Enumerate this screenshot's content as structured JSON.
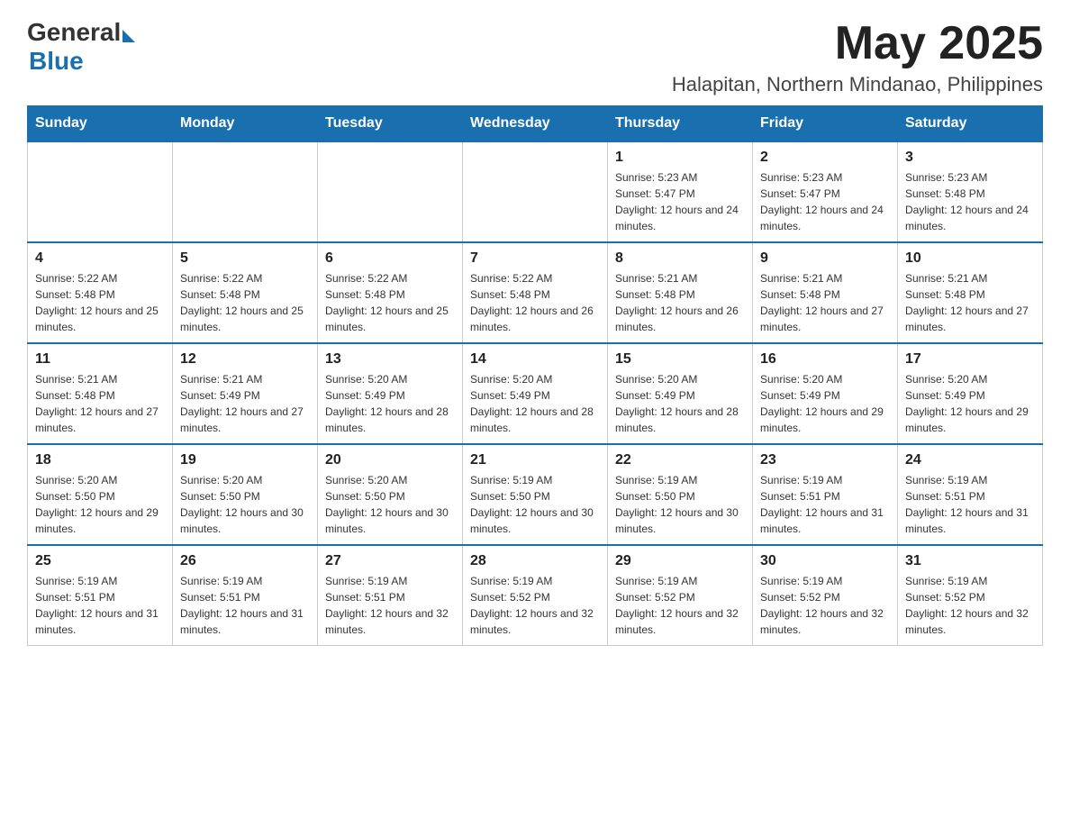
{
  "header": {
    "logo": {
      "general": "General",
      "blue": "Blue"
    },
    "monthYear": "May 2025",
    "location": "Halapitan, Northern Mindanao, Philippines"
  },
  "weekdays": [
    "Sunday",
    "Monday",
    "Tuesday",
    "Wednesday",
    "Thursday",
    "Friday",
    "Saturday"
  ],
  "weeks": [
    [
      {
        "day": "",
        "info": ""
      },
      {
        "day": "",
        "info": ""
      },
      {
        "day": "",
        "info": ""
      },
      {
        "day": "",
        "info": ""
      },
      {
        "day": "1",
        "info": "Sunrise: 5:23 AM\nSunset: 5:47 PM\nDaylight: 12 hours and 24 minutes."
      },
      {
        "day": "2",
        "info": "Sunrise: 5:23 AM\nSunset: 5:47 PM\nDaylight: 12 hours and 24 minutes."
      },
      {
        "day": "3",
        "info": "Sunrise: 5:23 AM\nSunset: 5:48 PM\nDaylight: 12 hours and 24 minutes."
      }
    ],
    [
      {
        "day": "4",
        "info": "Sunrise: 5:22 AM\nSunset: 5:48 PM\nDaylight: 12 hours and 25 minutes."
      },
      {
        "day": "5",
        "info": "Sunrise: 5:22 AM\nSunset: 5:48 PM\nDaylight: 12 hours and 25 minutes."
      },
      {
        "day": "6",
        "info": "Sunrise: 5:22 AM\nSunset: 5:48 PM\nDaylight: 12 hours and 25 minutes."
      },
      {
        "day": "7",
        "info": "Sunrise: 5:22 AM\nSunset: 5:48 PM\nDaylight: 12 hours and 26 minutes."
      },
      {
        "day": "8",
        "info": "Sunrise: 5:21 AM\nSunset: 5:48 PM\nDaylight: 12 hours and 26 minutes."
      },
      {
        "day": "9",
        "info": "Sunrise: 5:21 AM\nSunset: 5:48 PM\nDaylight: 12 hours and 27 minutes."
      },
      {
        "day": "10",
        "info": "Sunrise: 5:21 AM\nSunset: 5:48 PM\nDaylight: 12 hours and 27 minutes."
      }
    ],
    [
      {
        "day": "11",
        "info": "Sunrise: 5:21 AM\nSunset: 5:48 PM\nDaylight: 12 hours and 27 minutes."
      },
      {
        "day": "12",
        "info": "Sunrise: 5:21 AM\nSunset: 5:49 PM\nDaylight: 12 hours and 27 minutes."
      },
      {
        "day": "13",
        "info": "Sunrise: 5:20 AM\nSunset: 5:49 PM\nDaylight: 12 hours and 28 minutes."
      },
      {
        "day": "14",
        "info": "Sunrise: 5:20 AM\nSunset: 5:49 PM\nDaylight: 12 hours and 28 minutes."
      },
      {
        "day": "15",
        "info": "Sunrise: 5:20 AM\nSunset: 5:49 PM\nDaylight: 12 hours and 28 minutes."
      },
      {
        "day": "16",
        "info": "Sunrise: 5:20 AM\nSunset: 5:49 PM\nDaylight: 12 hours and 29 minutes."
      },
      {
        "day": "17",
        "info": "Sunrise: 5:20 AM\nSunset: 5:49 PM\nDaylight: 12 hours and 29 minutes."
      }
    ],
    [
      {
        "day": "18",
        "info": "Sunrise: 5:20 AM\nSunset: 5:50 PM\nDaylight: 12 hours and 29 minutes."
      },
      {
        "day": "19",
        "info": "Sunrise: 5:20 AM\nSunset: 5:50 PM\nDaylight: 12 hours and 30 minutes."
      },
      {
        "day": "20",
        "info": "Sunrise: 5:20 AM\nSunset: 5:50 PM\nDaylight: 12 hours and 30 minutes."
      },
      {
        "day": "21",
        "info": "Sunrise: 5:19 AM\nSunset: 5:50 PM\nDaylight: 12 hours and 30 minutes."
      },
      {
        "day": "22",
        "info": "Sunrise: 5:19 AM\nSunset: 5:50 PM\nDaylight: 12 hours and 30 minutes."
      },
      {
        "day": "23",
        "info": "Sunrise: 5:19 AM\nSunset: 5:51 PM\nDaylight: 12 hours and 31 minutes."
      },
      {
        "day": "24",
        "info": "Sunrise: 5:19 AM\nSunset: 5:51 PM\nDaylight: 12 hours and 31 minutes."
      }
    ],
    [
      {
        "day": "25",
        "info": "Sunrise: 5:19 AM\nSunset: 5:51 PM\nDaylight: 12 hours and 31 minutes."
      },
      {
        "day": "26",
        "info": "Sunrise: 5:19 AM\nSunset: 5:51 PM\nDaylight: 12 hours and 31 minutes."
      },
      {
        "day": "27",
        "info": "Sunrise: 5:19 AM\nSunset: 5:51 PM\nDaylight: 12 hours and 32 minutes."
      },
      {
        "day": "28",
        "info": "Sunrise: 5:19 AM\nSunset: 5:52 PM\nDaylight: 12 hours and 32 minutes."
      },
      {
        "day": "29",
        "info": "Sunrise: 5:19 AM\nSunset: 5:52 PM\nDaylight: 12 hours and 32 minutes."
      },
      {
        "day": "30",
        "info": "Sunrise: 5:19 AM\nSunset: 5:52 PM\nDaylight: 12 hours and 32 minutes."
      },
      {
        "day": "31",
        "info": "Sunrise: 5:19 AM\nSunset: 5:52 PM\nDaylight: 12 hours and 32 minutes."
      }
    ]
  ]
}
